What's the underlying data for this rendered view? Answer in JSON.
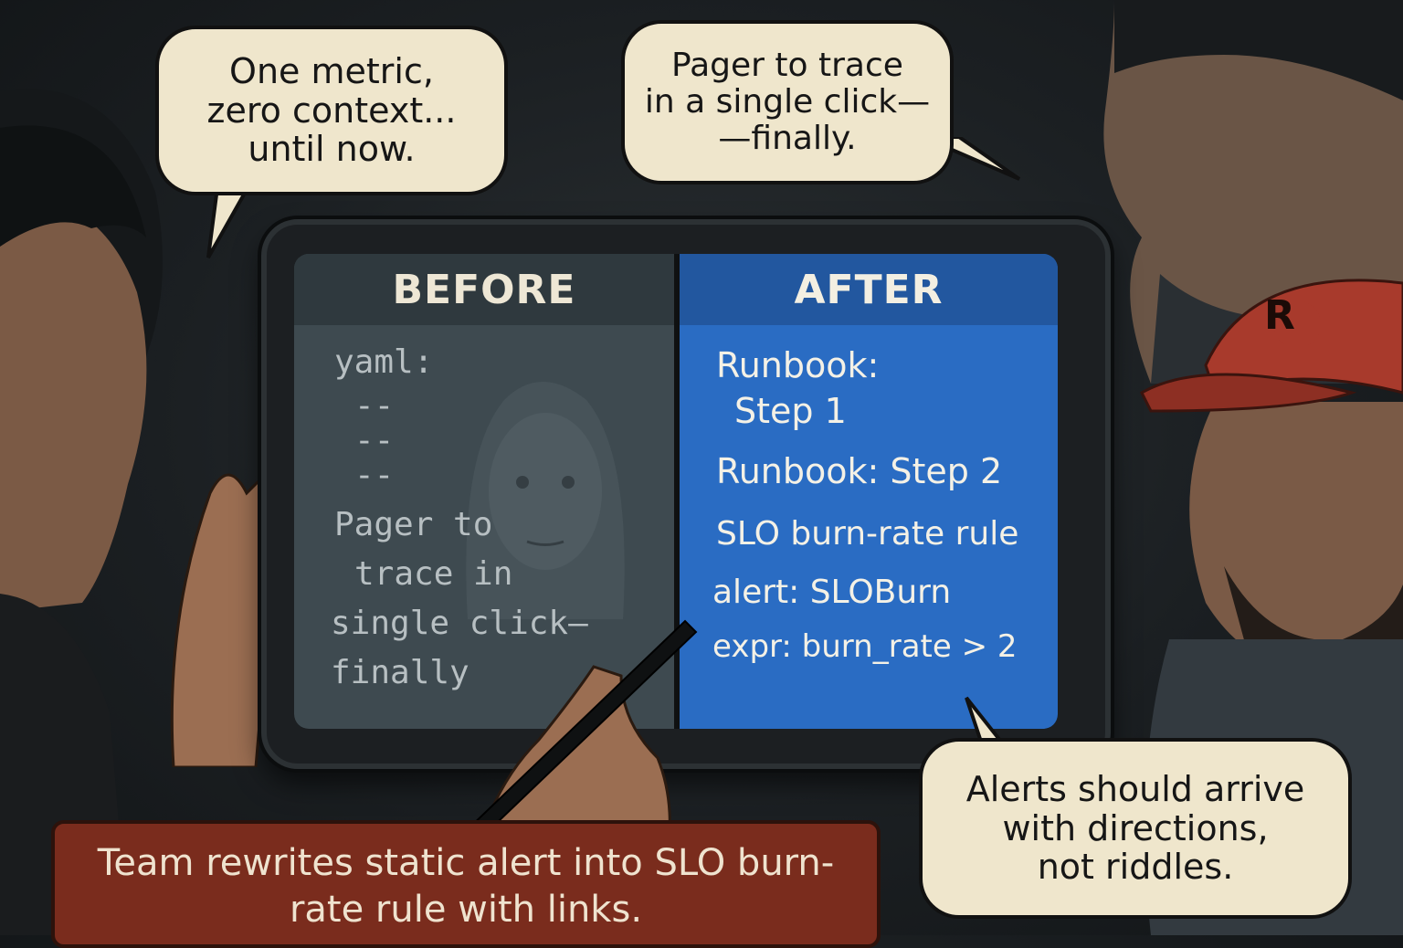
{
  "bubbles": {
    "left": [
      "One metric,",
      "zero context...",
      "until now."
    ],
    "top": [
      "Pager to trace",
      "in a single click—",
      "—finally."
    ],
    "right": [
      "Alerts should arrive",
      "with directions,",
      "not riddles."
    ]
  },
  "tablet": {
    "before": {
      "header": "BEFORE",
      "lines": [
        "yaml:",
        "--",
        "--",
        "--",
        "Pager to",
        "trace in",
        "single click—",
        "finally"
      ]
    },
    "after": {
      "header": "AFTER",
      "lines": [
        "Runbook:",
        "Step 1",
        "Runbook: Step 2",
        "SLO burn-rate rule",
        "alert: SLOBurn",
        "expr: burn_rate > 2"
      ]
    }
  },
  "caption": {
    "line1": "Team rewrites static alert into SLO burn-",
    "line2": "rate rule with links."
  },
  "colors": {
    "bubble": "#efe6cc",
    "before_panel": "#3e4a50",
    "after_panel": "#2a6cc3",
    "caption_bg": "#7a2c1d",
    "cap_logo_letter": "R"
  }
}
